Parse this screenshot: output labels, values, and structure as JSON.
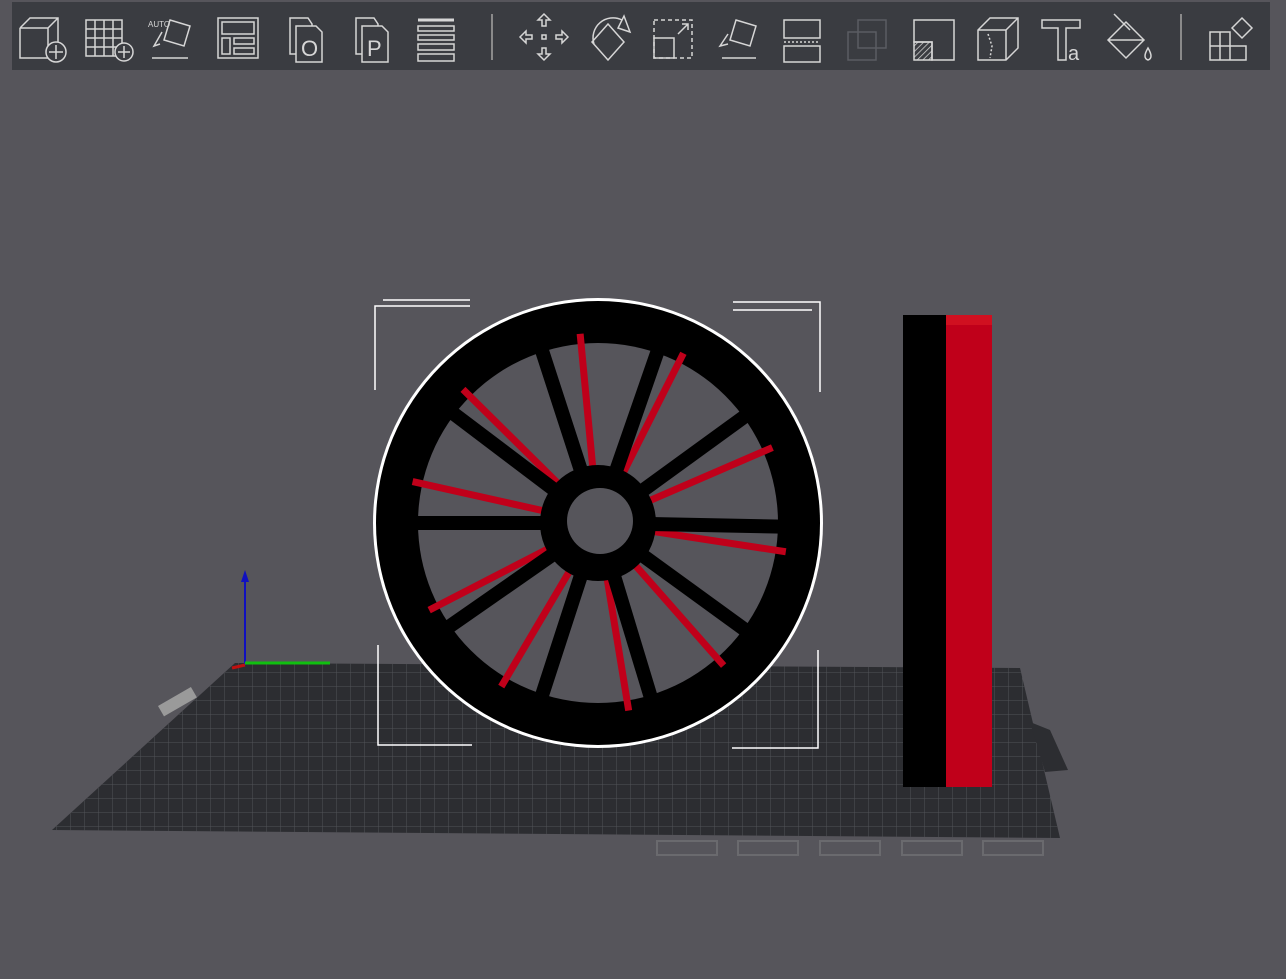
{
  "toolbar": {
    "items": [
      {
        "name": "add-object",
        "icon": "cube-plus-icon"
      },
      {
        "name": "add-plate",
        "icon": "grid-plus-icon"
      },
      {
        "name": "auto-orient",
        "icon": "auto-orient-icon",
        "label": "AUTO"
      },
      {
        "name": "arrange",
        "icon": "arrange-icon"
      },
      {
        "name": "copy",
        "icon": "copy-icon",
        "label": "O"
      },
      {
        "name": "paste",
        "icon": "paste-icon",
        "label": "P"
      },
      {
        "name": "layers",
        "icon": "layers-icon"
      },
      {
        "name": "move",
        "icon": "move-icon"
      },
      {
        "name": "rotate",
        "icon": "rotate-icon"
      },
      {
        "name": "scale",
        "icon": "scale-icon"
      },
      {
        "name": "lay-on-face",
        "icon": "lay-on-face-icon"
      },
      {
        "name": "cut",
        "icon": "cut-icon"
      },
      {
        "name": "boolean",
        "icon": "boolean-icon"
      },
      {
        "name": "support-painting",
        "icon": "support-paint-icon"
      },
      {
        "name": "seam-painting",
        "icon": "seam-paint-icon"
      },
      {
        "name": "text",
        "icon": "text-icon",
        "label": "a"
      },
      {
        "name": "color-painting",
        "icon": "paint-bucket-icon"
      },
      {
        "name": "assembly",
        "icon": "puzzle-icon"
      }
    ]
  },
  "colors": {
    "background": "#56555b",
    "toolbar": "#3a3c41",
    "accent_red": "#c0001a",
    "object_black": "#000000"
  }
}
